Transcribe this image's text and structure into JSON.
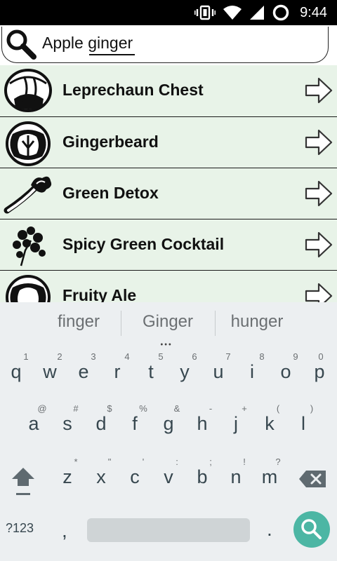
{
  "status_bar": {
    "time": "9:44",
    "icons": [
      "vibrate-icon",
      "wifi-icon",
      "signal-icon",
      "battery-icon"
    ]
  },
  "search": {
    "value": "Apple ginger",
    "underlined_word": "ginger"
  },
  "recipes": [
    {
      "name": "Leprechaun Chest",
      "icon": "lettuce-icon"
    },
    {
      "name": "Gingerbeard",
      "icon": "lettuce-icon"
    },
    {
      "name": "Green Detox",
      "icon": "celery-icon"
    },
    {
      "name": "Spicy Green Cocktail",
      "icon": "parsley-icon"
    },
    {
      "name": "Fruity Ale",
      "icon": "lettuce-icon"
    }
  ],
  "colors": {
    "list_background": "#e8f3e8",
    "keyboard_background": "#eceff1",
    "search_key": "#4cb6a4"
  },
  "keyboard": {
    "suggestions": [
      "finger",
      "Ginger",
      "hunger"
    ],
    "row1": [
      {
        "key": "q",
        "hint": "1"
      },
      {
        "key": "w",
        "hint": "2"
      },
      {
        "key": "e",
        "hint": "3"
      },
      {
        "key": "r",
        "hint": "4"
      },
      {
        "key": "t",
        "hint": "5"
      },
      {
        "key": "y",
        "hint": "6"
      },
      {
        "key": "u",
        "hint": "7"
      },
      {
        "key": "i",
        "hint": "8"
      },
      {
        "key": "o",
        "hint": "9"
      },
      {
        "key": "p",
        "hint": "0"
      }
    ],
    "row2": [
      {
        "key": "a",
        "hint": "@"
      },
      {
        "key": "s",
        "hint": "#"
      },
      {
        "key": "d",
        "hint": "$"
      },
      {
        "key": "f",
        "hint": "%"
      },
      {
        "key": "g",
        "hint": "&"
      },
      {
        "key": "h",
        "hint": "-"
      },
      {
        "key": "j",
        "hint": "+"
      },
      {
        "key": "k",
        "hint": "("
      },
      {
        "key": "l",
        "hint": ")"
      }
    ],
    "row3": [
      {
        "key": "z",
        "hint": "*"
      },
      {
        "key": "x",
        "hint": "\""
      },
      {
        "key": "c",
        "hint": "'"
      },
      {
        "key": "v",
        "hint": ":"
      },
      {
        "key": "b",
        "hint": ";"
      },
      {
        "key": "n",
        "hint": "!"
      },
      {
        "key": "m",
        "hint": "?"
      }
    ],
    "mode_label": "?123",
    "comma": ",",
    "period": "."
  }
}
